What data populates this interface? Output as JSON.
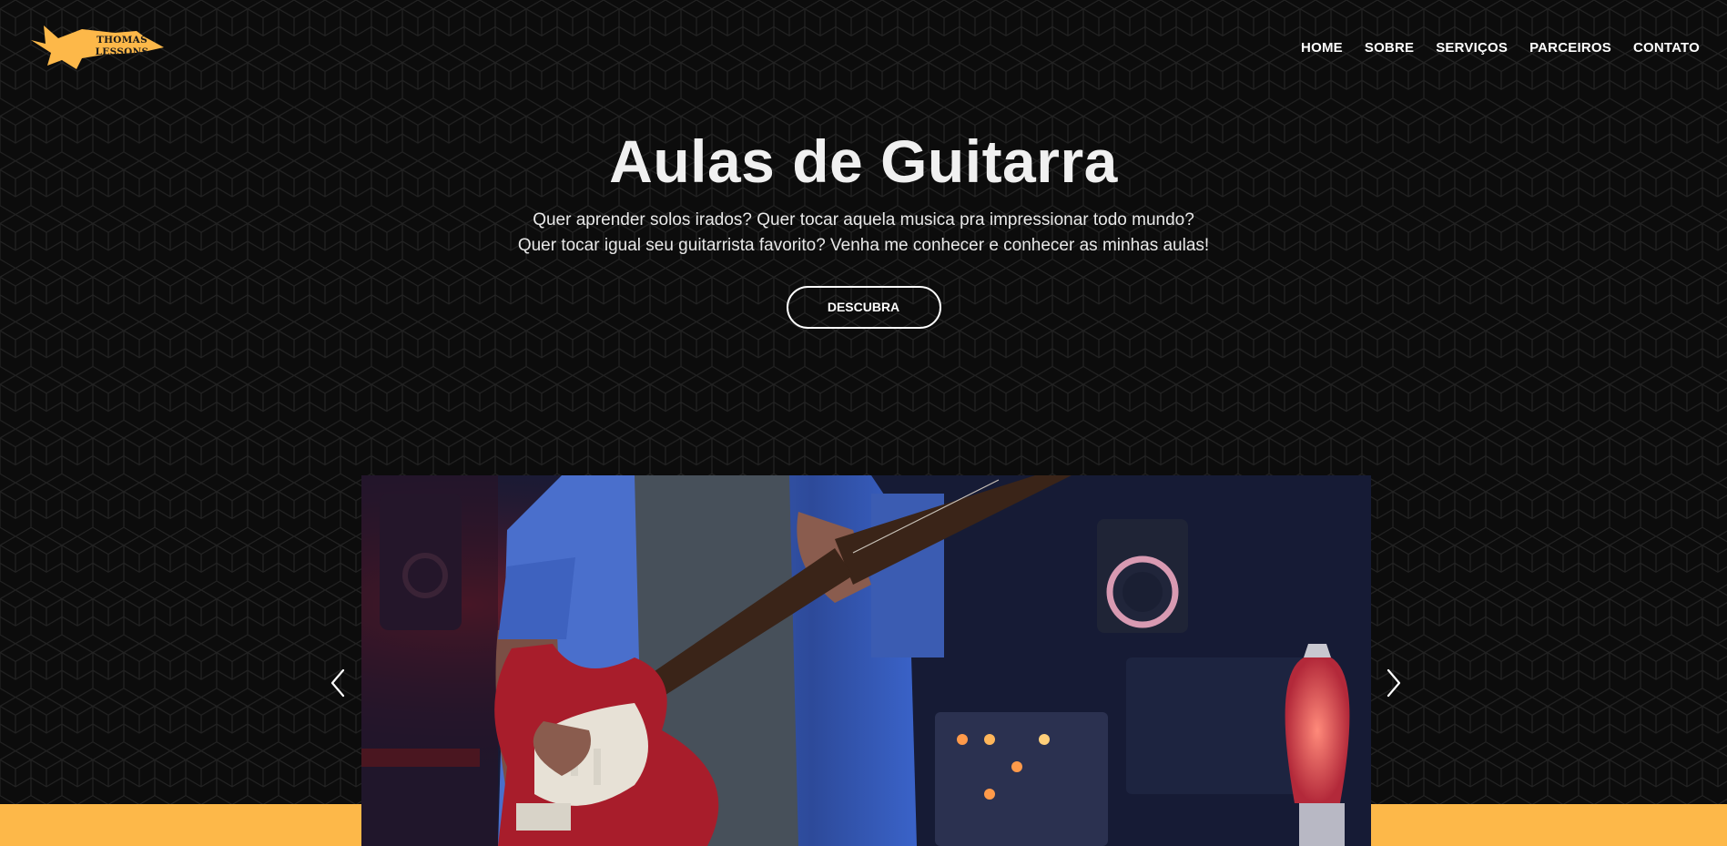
{
  "brand": {
    "line1": "THOMAS",
    "line2": "LESSONS",
    "color": "#fdb849"
  },
  "nav": {
    "items": [
      "HOME",
      "SOBRE",
      "SERVIÇOS",
      "PARCEIROS",
      "CONTATO"
    ]
  },
  "hero": {
    "title": "Aulas de Guitarra",
    "subtitle": "Quer aprender solos irados? Quer tocar aquela musica pra impressionar todo mundo? Quer tocar igual seu guitarrista favorito? Venha me conhecer e conhecer as minhas aulas!",
    "cta_label": "DESCUBRA"
  },
  "carousel": {
    "prev_icon": "chevron-left-icon",
    "next_icon": "chevron-right-icon"
  },
  "theme": {
    "background": "#0c0c0c",
    "accent": "#fdb849",
    "text": "#ffffff"
  }
}
